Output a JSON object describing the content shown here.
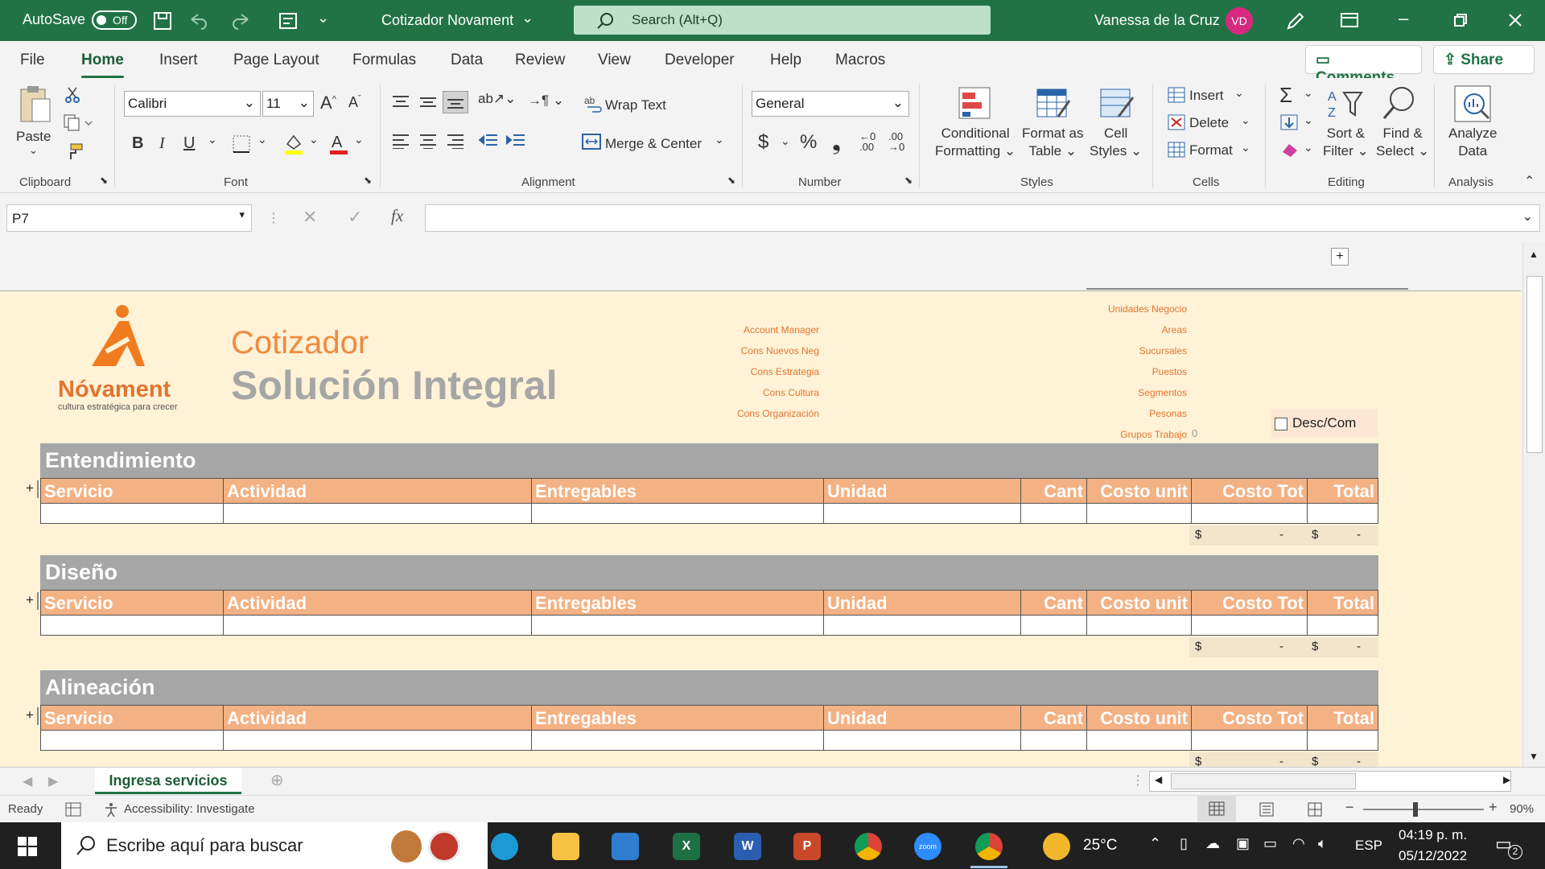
{
  "titlebar": {
    "autosave_label": "AutoSave",
    "autosave_state": "Off",
    "doc_title": "Cotizador Novament",
    "search_placeholder": "Search (Alt+Q)",
    "user_name": "Vanessa de la Cruz",
    "user_initials": "VD"
  },
  "menu": {
    "tabs": [
      "File",
      "Home",
      "Insert",
      "Page Layout",
      "Formulas",
      "Data",
      "Review",
      "View",
      "Developer",
      "Help",
      "Macros"
    ],
    "active": "Home",
    "comments_label": "Comments",
    "share_label": "Share"
  },
  "ribbon": {
    "clipboard": {
      "paste": "Paste",
      "label": "Clipboard"
    },
    "font": {
      "name": "Calibri",
      "size": "11",
      "label": "Font"
    },
    "alignment": {
      "wrap_text": "Wrap Text",
      "merge_center": "Merge & Center",
      "label": "Alignment"
    },
    "number": {
      "format": "General",
      "label": "Number"
    },
    "styles": {
      "conditional": "Conditional",
      "formatting": "Formatting",
      "format_as": "Format as",
      "table": "Table",
      "cell": "Cell",
      "cell_styles": "Styles",
      "label": "Styles"
    },
    "cells": {
      "insert": "Insert",
      "delete": "Delete",
      "format": "Format",
      "label": "Cells"
    },
    "editing": {
      "sort": "Sort &",
      "filter": "Filter",
      "find": "Find &",
      "select": "Select",
      "label": "Editing"
    },
    "analysis": {
      "analyze": "Analyze",
      "data": "Data",
      "label": "Analysis"
    }
  },
  "formula_bar": {
    "name_box": "P7",
    "fx": "fx",
    "value": ""
  },
  "sheet": {
    "logo_name": "Nóvament",
    "logo_tagline": "cultura estratégica para crecer",
    "title_line1": "Cotizador",
    "title_line2": "Solución Integral",
    "left_labels": [
      "Account Manager",
      "Cons Nuevos Neg",
      "Cons Estrategia",
      "Cons Cultura",
      "Cons Organización"
    ],
    "right_labels": [
      "Unidades Negocio",
      "Areas",
      "Sucursales",
      "Puestos",
      "Segmentos",
      "Pesonas",
      "Grupos Trabajo"
    ],
    "grupos_value": "0",
    "checkbox_label": "Desc/Com",
    "columns": [
      "Servicio",
      "Actividad",
      "Entregables",
      "Unidad",
      "Cant",
      "Costo unit",
      "Costo Tot",
      "Total"
    ],
    "sections": [
      "Entendimiento",
      "Diseño",
      "Alineación"
    ],
    "currency": "$",
    "dash": "-",
    "plus": "+"
  },
  "sheet_tabs": {
    "active": "Ingresa servicios"
  },
  "status": {
    "ready": "Ready",
    "accessibility": "Accessibility: Investigate",
    "zoom": "90%"
  },
  "taskbar": {
    "search_placeholder": "Escribe aquí para buscar",
    "weather": "25°C",
    "lang": "ESP",
    "time": "04:19 p. m.",
    "date": "05/12/2022",
    "notif_count": "2"
  },
  "colors": {
    "excel_green": "#217346",
    "header_orange": "#f4b183",
    "section_gray": "#a6a6a6",
    "sheet_bg": "#fff2d7",
    "accent_orange": "#e0752f"
  }
}
